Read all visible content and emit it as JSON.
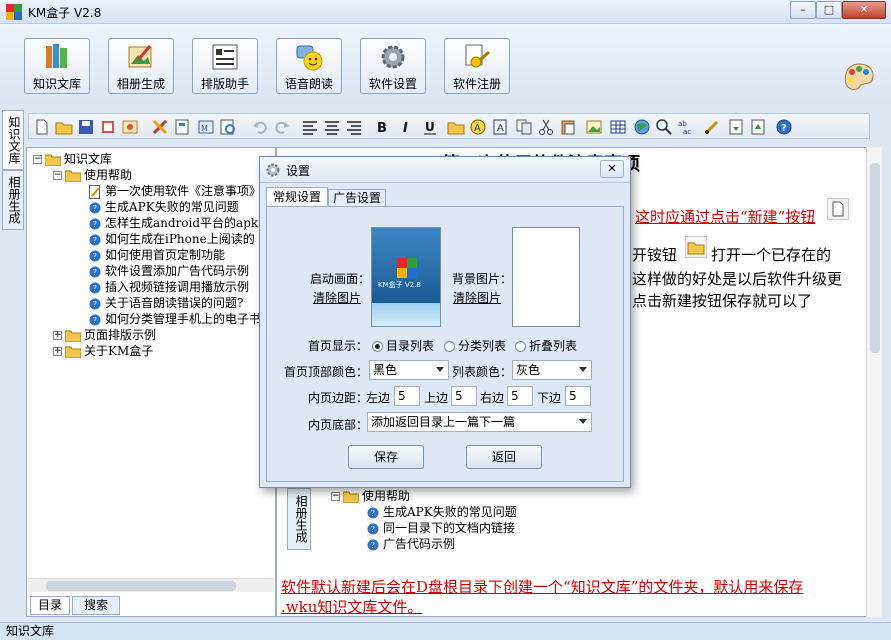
{
  "window": {
    "title": "KM盒子 V2.8"
  },
  "toolbar": {
    "buttons": [
      "知识文库",
      "相册生成",
      "排版助手",
      "语音朗读",
      "软件设置",
      "软件注册"
    ]
  },
  "side_tabs": [
    "知识文库",
    "相册生成"
  ],
  "tree": {
    "root": "知识文库",
    "help_folder": "使用帮助",
    "help_items": [
      "第一次使用软件《注意事项》",
      "生成APK失败的常见问题",
      "怎样生成android平台的apk",
      "如何生成在iPhone上阅读的",
      "如何使用首页定制功能",
      "软件设置添加广告代码示例",
      "插入视频链接调用播放示例",
      "关于语音朗读错误的问题?",
      "如何分类管理手机上的电子书"
    ],
    "layout_folder": "页面排版示例",
    "about_folder": "关于KM盒子"
  },
  "left_tabs": [
    "目录",
    "搜索"
  ],
  "editor": {
    "heading": "第一次使用软件注意事项",
    "line1": "这时应通过点击“新建”按钮",
    "line2a": "开铵钮",
    "line2b": "打开一个已存在的",
    "line3": "这样做的好处是以后软件升级更",
    "line4": "点击新建按钮保存就可以了",
    "embed_side_label": "相册生成",
    "embed_folder": "使用帮助",
    "embed_items": [
      "生成APK失败的常见问题",
      "同一目录下的文档内链接",
      "广告代码示例"
    ],
    "footer1": "软件默认新建后会在D盘根目录下创建一个“知识文库”的文件夹，默认用来保存",
    "footer2": ".wku知识文库文件。"
  },
  "status": {
    "text": "知识文库"
  },
  "dialog": {
    "title": "设置",
    "tabs": [
      "常规设置",
      "广告设置"
    ],
    "startup_label": "启动画面：",
    "clear_startup": "清除图片",
    "splash_title": "KM盒子 V2.8",
    "bg_label": "背景图片：",
    "clear_bg": "清除图片",
    "home_display_label": "首页显示：",
    "home_display_options": [
      "目录列表",
      "分类列表",
      "折叠列表"
    ],
    "home_display_selected": "目录列表",
    "top_color_label": "首页顶部颜色：",
    "top_color_value": "黑色",
    "list_color_label": "列表颜色：",
    "list_color_value": "灰色",
    "margin_label": "内页边距：",
    "margins": [
      {
        "label": "左边",
        "value": "5"
      },
      {
        "label": "上边",
        "value": "5"
      },
      {
        "label": "右边",
        "value": "5"
      },
      {
        "label": "下边",
        "value": "5"
      }
    ],
    "bottom_label": "内页底部：",
    "bottom_value": "添加返回目录上一篇下一篇",
    "save": "保存",
    "back": "返回"
  },
  "colors": {
    "accent_red": "#d40000",
    "panel_bg": "#dde8f3",
    "dialog_bg": "#dfe9f5"
  }
}
